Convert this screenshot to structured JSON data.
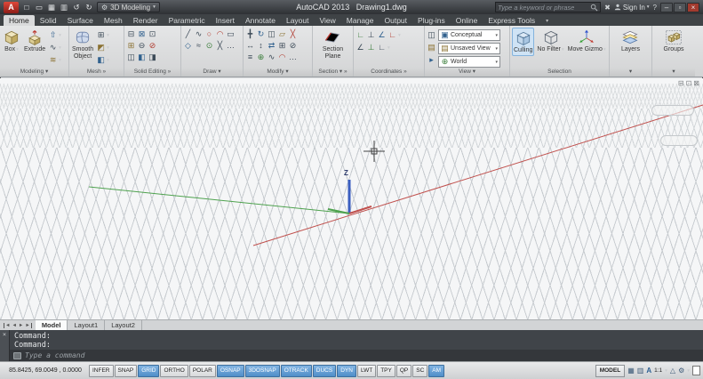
{
  "colors": {
    "brand_red": "#b02425",
    "active_blue": "#4f8ec9",
    "selection_highlight": "#cfe3f5",
    "grid_line": "#c8ccd0"
  },
  "ui": {
    "caret": "▾",
    "expander": "»",
    "gear_glyph": "⚙"
  },
  "titlebar": {
    "logo_glyph": "A",
    "qat_icons": [
      {
        "name": "qnew",
        "glyph": "□"
      },
      {
        "name": "open",
        "glyph": "▭"
      },
      {
        "name": "save",
        "glyph": "▦"
      },
      {
        "name": "plot",
        "glyph": "▥"
      },
      {
        "name": "undo",
        "glyph": "↺"
      },
      {
        "name": "redo",
        "glyph": "↻"
      }
    ],
    "workspace": "3D Modeling",
    "title": "AutoCAD 2013   Drawing1.dwg",
    "search_placeholder": "Type a keyword or phrase",
    "exchange_glyph": "✖",
    "sign_in": "Sign In",
    "help_glyph": "?",
    "window_icons": {
      "minimize": "–",
      "maximize": "▫",
      "close": "×"
    }
  },
  "tabs": [
    "Home",
    "Solid",
    "Surface",
    "Mesh",
    "Render",
    "Parametric",
    "Insert",
    "Annotate",
    "Layout",
    "View",
    "Manage",
    "Output",
    "Plug-ins",
    "Online",
    "Express Tools"
  ],
  "ribbon": {
    "modeling": {
      "title": "Modeling ▾",
      "box_label": "Box",
      "extrude_label": "Extrude",
      "small_icons": [
        "⇧",
        "∿",
        "≋"
      ]
    },
    "mesh": {
      "title": "Mesh »",
      "smooth_1": "Smooth",
      "smooth_2": "Object",
      "small_icons": [
        "⊞",
        "◩",
        "◧"
      ]
    },
    "solid_editing": {
      "title": "Solid Editing »",
      "icons": [
        "⊟",
        "⊠",
        "⊡",
        "⊞",
        "⊖",
        "⊘",
        "◫",
        "◧",
        "◨"
      ]
    },
    "draw": {
      "title": "Draw ▾",
      "icons": [
        "╱",
        "∿",
        "○",
        "◠",
        "▭",
        "◇",
        "≈",
        "⊙",
        "╳",
        "…"
      ]
    },
    "modify": {
      "title": "Modify ▾",
      "icons": [
        "╋",
        "↻",
        "◫",
        "▱",
        "╳",
        "↔",
        "↕",
        "⇄",
        "⊞",
        "⊘",
        "≡",
        "⊕",
        "∿",
        "◠",
        "…"
      ]
    },
    "section": {
      "title": "Section ▾ »",
      "label_1": "Section",
      "label_2": "Plane"
    },
    "coordinates": {
      "title": "Coordinates »",
      "icons_row1": [
        "∟",
        "⊥",
        "∠",
        "∟"
      ],
      "icons_row2": [
        "∠",
        "⊥",
        "∟"
      ]
    },
    "view": {
      "title": "View ▾",
      "left_icons": [
        "◫",
        "▤",
        "▸"
      ],
      "combos": [
        {
          "name": "visual-style",
          "icon": "▣",
          "value": "Conceptual"
        },
        {
          "name": "named-view",
          "icon": "▤",
          "value": "Unsaved View"
        },
        {
          "name": "ucs",
          "icon": "⊕",
          "value": "World"
        }
      ]
    },
    "selection": {
      "title": "Selection",
      "culling": "Culling",
      "no_filter": "No Filter",
      "move_gizmo": "Move Gizmo"
    },
    "layers": {
      "title": "▾",
      "label": "Layers"
    },
    "groups": {
      "title": "▾",
      "label": "Groups"
    }
  },
  "canvas": {
    "z_label": "Z",
    "window_icons": {
      "minimize": "⊟",
      "restore": "⊡",
      "close": "⊠"
    }
  },
  "layout_bar": {
    "nav_icons": [
      "◄",
      "◄",
      "►",
      "►"
    ],
    "tabs": [
      "Model",
      "Layout1",
      "Layout2"
    ]
  },
  "command": {
    "close_glyph": "×",
    "history": [
      "Command:",
      "Command:"
    ],
    "prompt": "Type a command"
  },
  "statusbar": {
    "coords": "85.8425,  69.0049 ,  0.0000",
    "toggles": [
      {
        "label": "INFER",
        "on": false
      },
      {
        "label": "SNAP",
        "on": false
      },
      {
        "label": "GRID",
        "on": true
      },
      {
        "label": "ORTHO",
        "on": false
      },
      {
        "label": "POLAR",
        "on": false
      },
      {
        "label": "OSNAP",
        "on": true
      },
      {
        "label": "3DOSNAP",
        "on": true
      },
      {
        "label": "OTRACK",
        "on": true
      },
      {
        "label": "DUCS",
        "on": true
      },
      {
        "label": "DYN",
        "on": true
      },
      {
        "label": "LWT",
        "on": false
      },
      {
        "label": "TPY",
        "on": false
      },
      {
        "label": "QP",
        "on": false
      },
      {
        "label": "SC",
        "on": false
      },
      {
        "label": "AM",
        "on": true
      }
    ],
    "model": "MODEL",
    "scale_icon": "A",
    "scale": "1:1",
    "right_icons": [
      {
        "name": "quick-view-layouts",
        "glyph": "▦"
      },
      {
        "name": "quick-view-drawings",
        "glyph": "▥"
      }
    ],
    "right_icons_b": [
      {
        "name": "annotation-visibility",
        "glyph": "△"
      }
    ]
  }
}
